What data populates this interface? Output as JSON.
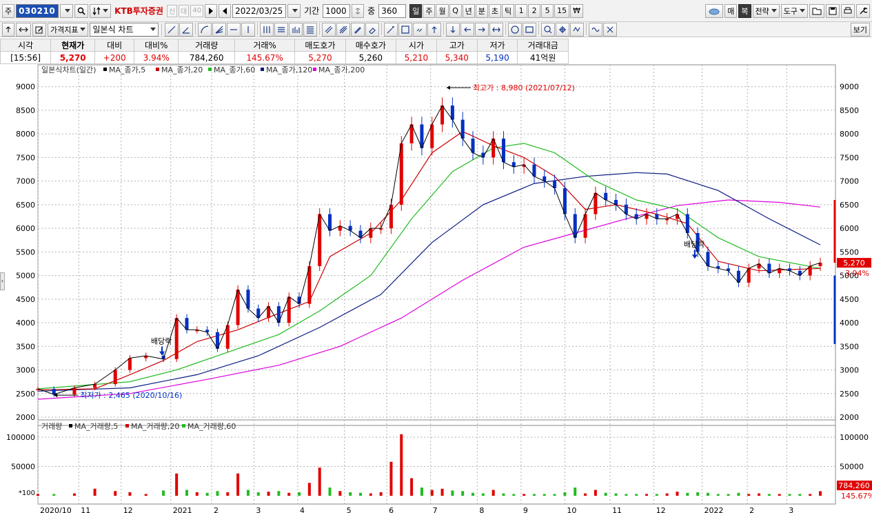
{
  "toolbar": {
    "market_label": "주",
    "code": "030210",
    "stock_name": "KTB투자증권",
    "tag1": "신",
    "tag2": "대",
    "tag3": "40",
    "date": "2022/03/25",
    "period_label": "기간",
    "period_value": "1000",
    "count_label": "중",
    "count_value": "360",
    "intervals": [
      "일",
      "주",
      "월",
      "Q",
      "년",
      "분",
      "초",
      "틱",
      "1",
      "2",
      "5",
      "15",
      "₩"
    ],
    "interval_selected": "일",
    "right_buttons": [
      "매",
      "복",
      "전략",
      "도구"
    ],
    "right_selected": "복",
    "price_indicator": "가격지표",
    "chart_type": "일본식 차트",
    "view_label": "보기"
  },
  "quote": {
    "headers": [
      "시각",
      "현재가",
      "대비",
      "대비%",
      "거래량",
      "거래%",
      "매도호가",
      "매수호가",
      "시가",
      "고가",
      "저가",
      "거래대금"
    ],
    "values": [
      "[15:56]",
      "5,270",
      "+200",
      "3.94%",
      "784,260",
      "145.67%",
      "5,270",
      "5,260",
      "5,210",
      "5,340",
      "5,190",
      "41억원"
    ]
  },
  "colors": {
    "up": "#e00000",
    "down": "#0030c0",
    "ma5": "#000000",
    "ma20": "#cc0000",
    "ma60": "#22bb22",
    "ma120": "#0a1a80",
    "ma200": "#dd00dd",
    "grid": "#b0b0b0"
  },
  "chart_data": {
    "type": "line",
    "price_legend": {
      "title": "일본식차트(일간)",
      "items": [
        "MA_종가,5",
        "MA_종가,20",
        "MA_종가,60",
        "MA_종가,120",
        "MA_종가,200"
      ]
    },
    "volume_legend": {
      "title": "거래량",
      "items": [
        "MA_거래량,5",
        "MA_거래량,20",
        "MA_거래량,60"
      ]
    },
    "x_labels": [
      "2020/10",
      "11",
      "12",
      "2021",
      "2",
      "3",
      "4",
      "5",
      "6",
      "7",
      "8",
      "9",
      "10",
      "11",
      "12",
      "2022",
      "2",
      "3"
    ],
    "x_label_dates": [
      "2020-10-05",
      "2020-11-02",
      "2020-12-01",
      "2021-01-04",
      "2021-02-01",
      "2021-03-02",
      "2021-04-01",
      "2021-05-03",
      "2021-06-01",
      "2021-07-01",
      "2021-08-02",
      "2021-09-01",
      "2021-10-01",
      "2021-11-01",
      "2021-12-01",
      "2022-01-03",
      "2022-02-03",
      "2022-03-02"
    ],
    "y_ticks": [
      2000,
      2500,
      3000,
      3500,
      4000,
      4500,
      5000,
      5500,
      6000,
      6500,
      7000,
      7500,
      8000,
      8500,
      9000
    ],
    "ylim": [
      2000,
      9200
    ],
    "volume_ticks": [
      50000,
      100000
    ],
    "volume_ylim": [
      0,
      120000
    ],
    "volume_scale_label": "*100",
    "close": [
      [
        "2020-10-05",
        2600
      ],
      [
        "2020-10-16",
        2480
      ],
      [
        "2020-10-30",
        2620
      ],
      [
        "2020-11-13",
        2700
      ],
      [
        "2020-11-27",
        3000
      ],
      [
        "2020-12-07",
        3250
      ],
      [
        "2020-12-18",
        3300
      ],
      [
        "2020-12-30",
        3230
      ],
      [
        "2021-01-08",
        4100
      ],
      [
        "2021-01-15",
        3850
      ],
      [
        "2021-01-22",
        3850
      ],
      [
        "2021-01-29",
        3800
      ],
      [
        "2021-02-05",
        3450
      ],
      [
        "2021-02-12",
        3950
      ],
      [
        "2021-02-19",
        4700
      ],
      [
        "2021-02-26",
        4300
      ],
      [
        "2021-03-05",
        4100
      ],
      [
        "2021-03-12",
        4350
      ],
      [
        "2021-03-19",
        4000
      ],
      [
        "2021-03-26",
        4550
      ],
      [
        "2021-04-02",
        4400
      ],
      [
        "2021-04-09",
        5200
      ],
      [
        "2021-04-16",
        6300
      ],
      [
        "2021-04-23",
        5950
      ],
      [
        "2021-04-30",
        6050
      ],
      [
        "2021-05-07",
        5950
      ],
      [
        "2021-05-14",
        5800
      ],
      [
        "2021-05-21",
        6000
      ],
      [
        "2021-05-28",
        6000
      ],
      [
        "2021-06-04",
        6500
      ],
      [
        "2021-06-11",
        7800
      ],
      [
        "2021-06-18",
        8200
      ],
      [
        "2021-06-25",
        7700
      ],
      [
        "2021-07-02",
        8200
      ],
      [
        "2021-07-09",
        8600
      ],
      [
        "2021-07-16",
        8300
      ],
      [
        "2021-07-23",
        7900
      ],
      [
        "2021-07-30",
        7600
      ],
      [
        "2021-08-06",
        7500
      ],
      [
        "2021-08-13",
        7900
      ],
      [
        "2021-08-20",
        7400
      ],
      [
        "2021-08-27",
        7300
      ],
      [
        "2021-09-03",
        7350
      ],
      [
        "2021-09-10",
        7100
      ],
      [
        "2021-09-17",
        7000
      ],
      [
        "2021-09-24",
        6850
      ],
      [
        "2021-10-01",
        6300
      ],
      [
        "2021-10-08",
        5800
      ],
      [
        "2021-10-15",
        6300
      ],
      [
        "2021-10-22",
        6750
      ],
      [
        "2021-10-29",
        6600
      ],
      [
        "2021-11-05",
        6500
      ],
      [
        "2021-11-12",
        6300
      ],
      [
        "2021-11-19",
        6200
      ],
      [
        "2021-11-26",
        6300
      ],
      [
        "2021-12-03",
        6200
      ],
      [
        "2021-12-10",
        6200
      ],
      [
        "2021-12-17",
        6300
      ],
      [
        "2021-12-24",
        5900
      ],
      [
        "2021-12-31",
        5500
      ],
      [
        "2022-01-07",
        5200
      ],
      [
        "2022-01-14",
        5150
      ],
      [
        "2022-01-21",
        5100
      ],
      [
        "2022-01-28",
        4850
      ],
      [
        "2022-02-04",
        5150
      ],
      [
        "2022-02-11",
        5250
      ],
      [
        "2022-02-18",
        5050
      ],
      [
        "2022-02-25",
        5150
      ],
      [
        "2022-03-04",
        5100
      ],
      [
        "2022-03-11",
        5000
      ],
      [
        "2022-03-18",
        5200
      ],
      [
        "2022-03-25",
        5270
      ]
    ],
    "ma20": [
      [
        "2020-10-05",
        2580
      ],
      [
        "2020-11-13",
        2600
      ],
      [
        "2020-12-07",
        2900
      ],
      [
        "2020-12-30",
        3200
      ],
      [
        "2021-01-22",
        3600
      ],
      [
        "2021-02-19",
        3850
      ],
      [
        "2021-03-19",
        4200
      ],
      [
        "2021-04-09",
        4450
      ],
      [
        "2021-04-23",
        5400
      ],
      [
        "2021-05-21",
        5900
      ],
      [
        "2021-06-11",
        6600
      ],
      [
        "2021-07-02",
        7600
      ],
      [
        "2021-07-23",
        8050
      ],
      [
        "2021-08-13",
        7750
      ],
      [
        "2021-09-03",
        7500
      ],
      [
        "2021-09-24",
        7100
      ],
      [
        "2021-10-15",
        6400
      ],
      [
        "2021-11-05",
        6500
      ],
      [
        "2021-12-03",
        6300
      ],
      [
        "2021-12-24",
        6100
      ],
      [
        "2022-01-14",
        5300
      ],
      [
        "2022-02-11",
        5100
      ],
      [
        "2022-03-25",
        5150
      ]
    ],
    "ma60": [
      [
        "2020-10-05",
        2600
      ],
      [
        "2020-12-07",
        2750
      ],
      [
        "2021-01-08",
        3000
      ],
      [
        "2021-02-19",
        3450
      ],
      [
        "2021-03-19",
        3750
      ],
      [
        "2021-04-16",
        4250
      ],
      [
        "2021-05-21",
        5000
      ],
      [
        "2021-06-18",
        6200
      ],
      [
        "2021-07-16",
        7200
      ],
      [
        "2021-08-13",
        7700
      ],
      [
        "2021-09-03",
        7800
      ],
      [
        "2021-09-24",
        7600
      ],
      [
        "2021-10-22",
        7000
      ],
      [
        "2021-11-19",
        6600
      ],
      [
        "2021-12-17",
        6400
      ],
      [
        "2022-01-14",
        5800
      ],
      [
        "2022-02-11",
        5400
      ],
      [
        "2022-03-25",
        5150
      ]
    ],
    "ma120": [
      [
        "2020-10-05",
        2550
      ],
      [
        "2020-12-07",
        2620
      ],
      [
        "2021-01-22",
        2900
      ],
      [
        "2021-03-05",
        3300
      ],
      [
        "2021-04-16",
        3900
      ],
      [
        "2021-05-28",
        4600
      ],
      [
        "2021-07-02",
        5700
      ],
      [
        "2021-08-06",
        6500
      ],
      [
        "2021-09-10",
        6950
      ],
      [
        "2021-10-15",
        7100
      ],
      [
        "2021-11-19",
        7180
      ],
      [
        "2021-12-10",
        7150
      ],
      [
        "2022-01-14",
        6800
      ],
      [
        "2022-02-18",
        6200
      ],
      [
        "2022-03-25",
        5650
      ]
    ],
    "ma200": [
      [
        "2020-10-05",
        2380
      ],
      [
        "2020-12-07",
        2500
      ],
      [
        "2021-01-29",
        2800
      ],
      [
        "2021-03-19",
        3100
      ],
      [
        "2021-04-30",
        3500
      ],
      [
        "2021-06-11",
        4100
      ],
      [
        "2021-07-23",
        4900
      ],
      [
        "2021-09-03",
        5600
      ],
      [
        "2021-10-08",
        5900
      ],
      [
        "2021-11-12",
        6200
      ],
      [
        "2021-12-17",
        6480
      ],
      [
        "2022-01-21",
        6600
      ],
      [
        "2022-02-25",
        6550
      ],
      [
        "2022-03-25",
        6450
      ]
    ],
    "volume": [
      [
        "2020-10-05",
        3000
      ],
      [
        "2020-10-16",
        3000
      ],
      [
        "2020-10-30",
        4000
      ],
      [
        "2020-11-13",
        12000
      ],
      [
        "2020-11-27",
        8000
      ],
      [
        "2020-12-07",
        6000
      ],
      [
        "2020-12-18",
        3000
      ],
      [
        "2020-12-30",
        9000
      ],
      [
        "2021-01-08",
        38000
      ],
      [
        "2021-01-15",
        10000
      ],
      [
        "2021-01-22",
        6000
      ],
      [
        "2021-01-29",
        5000
      ],
      [
        "2021-02-05",
        8000
      ],
      [
        "2021-02-12",
        6000
      ],
      [
        "2021-02-19",
        38000
      ],
      [
        "2021-02-26",
        10000
      ],
      [
        "2021-03-05",
        6000
      ],
      [
        "2021-03-12",
        7000
      ],
      [
        "2021-03-19",
        8000
      ],
      [
        "2021-03-26",
        5000
      ],
      [
        "2021-04-02",
        6000
      ],
      [
        "2021-04-09",
        22000
      ],
      [
        "2021-04-16",
        48000
      ],
      [
        "2021-04-23",
        14000
      ],
      [
        "2021-04-30",
        8000
      ],
      [
        "2021-05-07",
        6000
      ],
      [
        "2021-05-14",
        5000
      ],
      [
        "2021-05-21",
        4000
      ],
      [
        "2021-05-28",
        6000
      ],
      [
        "2021-06-04",
        58000
      ],
      [
        "2021-06-11",
        105000
      ],
      [
        "2021-06-18",
        30000
      ],
      [
        "2021-06-25",
        14000
      ],
      [
        "2021-07-02",
        10000
      ],
      [
        "2021-07-09",
        12000
      ],
      [
        "2021-07-16",
        9000
      ],
      [
        "2021-07-23",
        8000
      ],
      [
        "2021-07-30",
        5000
      ],
      [
        "2021-08-06",
        4000
      ],
      [
        "2021-08-13",
        10000
      ],
      [
        "2021-08-20",
        4000
      ],
      [
        "2021-08-27",
        3000
      ],
      [
        "2021-09-03",
        3000
      ],
      [
        "2021-09-10",
        3000
      ],
      [
        "2021-09-17",
        3000
      ],
      [
        "2021-09-24",
        3000
      ],
      [
        "2021-10-01",
        6000
      ],
      [
        "2021-10-08",
        14000
      ],
      [
        "2021-10-15",
        4000
      ],
      [
        "2021-10-22",
        10000
      ],
      [
        "2021-10-29",
        5000
      ],
      [
        "2021-11-05",
        4000
      ],
      [
        "2021-11-12",
        3000
      ],
      [
        "2021-11-19",
        3000
      ],
      [
        "2021-11-26",
        3000
      ],
      [
        "2021-12-03",
        3000
      ],
      [
        "2021-12-10",
        4000
      ],
      [
        "2021-12-17",
        7000
      ],
      [
        "2021-12-24",
        5000
      ],
      [
        "2021-12-31",
        6000
      ],
      [
        "2022-01-07",
        5000
      ],
      [
        "2022-01-14",
        3000
      ],
      [
        "2022-01-21",
        3000
      ],
      [
        "2022-01-28",
        5000
      ],
      [
        "2022-02-04",
        3000
      ],
      [
        "2022-02-11",
        4000
      ],
      [
        "2022-02-18",
        3000
      ],
      [
        "2022-02-25",
        3000
      ],
      [
        "2022-03-04",
        3000
      ],
      [
        "2022-03-11",
        3000
      ],
      [
        "2022-03-18",
        3000
      ],
      [
        "2022-03-25",
        7800
      ]
    ],
    "annotations": {
      "high": {
        "text": "최고가 : 8,980 (2021/07/12)",
        "date": "2021-07-12",
        "value": 8980
      },
      "low": {
        "text": "최저가 : 2,465 (2020/10/16)",
        "date": "2020-10-16",
        "value": 2465
      },
      "dividend_markers": [
        {
          "text": "배당락",
          "date": "2020-12-29",
          "value": 3350
        },
        {
          "text": "배당락",
          "date": "2021-12-29",
          "value": 5400
        }
      ]
    },
    "price_badge": {
      "value": "5,270",
      "change": "3.94%"
    },
    "volume_badge": {
      "value": "784,260",
      "change": "145.67%"
    }
  }
}
